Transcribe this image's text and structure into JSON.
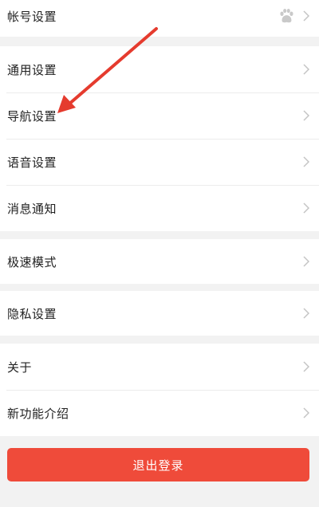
{
  "settings": {
    "account": {
      "label": "帐号设置",
      "avatar_icon": "paw-icon"
    },
    "general": "通用设置",
    "navigation": "导航设置",
    "voice": "语音设置",
    "notifications": "消息通知",
    "speed_mode": "极速模式",
    "privacy": "隐私设置",
    "about": "关于",
    "new_features": "新功能介绍"
  },
  "logout_label": "退出登录",
  "colors": {
    "logout_bg": "#ef4b3a",
    "annotation_arrow": "#e53b2e",
    "page_bg": "#f2f2f2"
  }
}
